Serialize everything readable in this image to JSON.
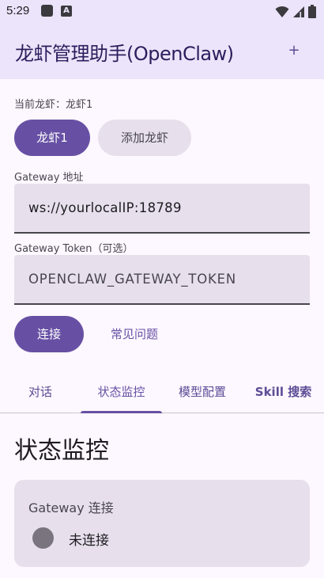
{
  "status_bar": {
    "time": "5:29"
  },
  "app_bar": {
    "title": "龙虾管理助手(OpenClaw)",
    "add_icon_glyph": "+"
  },
  "current": {
    "label": "当前龙虾：龙虾1"
  },
  "chips": {
    "selected": "龙虾1",
    "add": "添加龙虾"
  },
  "gateway": {
    "label": "Gateway 地址",
    "value": "ws://yourlocalIP:18789"
  },
  "token": {
    "label": "Gateway Token（可选）",
    "value": "OPENCLAW_GATEWAY_TOKEN"
  },
  "actions": {
    "connect": "连接",
    "faq": "常见问题"
  },
  "tabs": [
    {
      "label": "对话"
    },
    {
      "label": "状态监控"
    },
    {
      "label": "模型配置"
    },
    {
      "label": "Skill 搜索"
    }
  ],
  "section": {
    "title": "状态监控"
  },
  "card": {
    "title": "Gateway 连接",
    "status": "未连接"
  },
  "colors": {
    "primary": "#6750a4",
    "app_bar_bg": "#ece4fa",
    "surface_variant": "#e7e0ec",
    "status_dot": "#79747e"
  }
}
